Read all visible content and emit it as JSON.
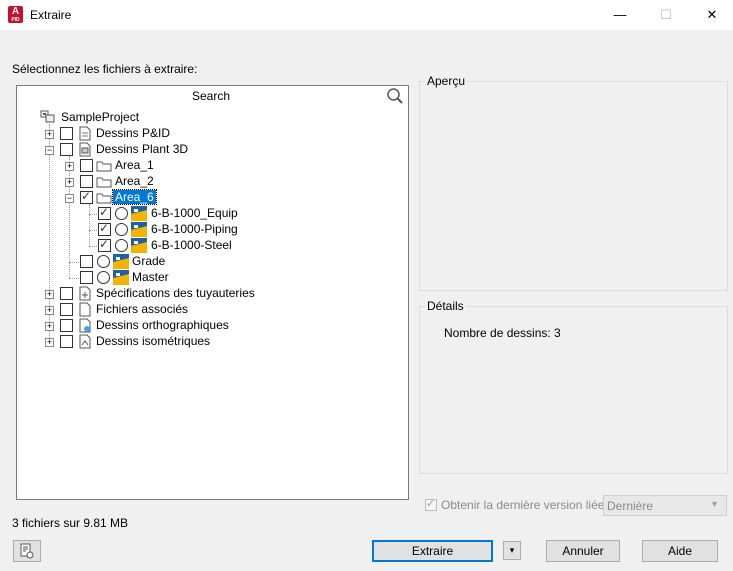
{
  "window": {
    "title": "Extraire",
    "app_icon_letter": "A",
    "app_icon_sub": "PID",
    "minimize": "—",
    "maximize": "☐",
    "close": "✕"
  },
  "select_label": "Sélectionnez les fichiers à extraire:",
  "search": {
    "label": "Search"
  },
  "tree": {
    "root": "SampleProject",
    "dessins_pid": "Dessins P&ID",
    "dessins_plant": "Dessins Plant 3D",
    "area_1": "Area_1",
    "area_2": "Area_2",
    "area_6": "Area_6",
    "equip": "6-B-1000_Equip",
    "piping": "6-B-1000-Piping",
    "steel": "6-B-1000-Steel",
    "grade": "Grade",
    "master": "Master",
    "specs": "Spécifications des tuyauteries",
    "fichiers": "Fichiers associés",
    "ortho": "Dessins orthographiques",
    "iso": "Dessins isométriques"
  },
  "apercu": {
    "title": "Aperçu"
  },
  "details": {
    "title": "Détails",
    "count_text": "Nombre de dessins: 3"
  },
  "latest": {
    "label": "Obtenir la dernière version liée",
    "select_value": "Dernière"
  },
  "status": "3 fichiers sur 9.81 MB",
  "buttons": {
    "extraire": "Extraire",
    "annuler": "Annuler",
    "aide": "Aide"
  },
  "colors": {
    "selection": "#0078d7",
    "app_icon": "#c8102e"
  }
}
